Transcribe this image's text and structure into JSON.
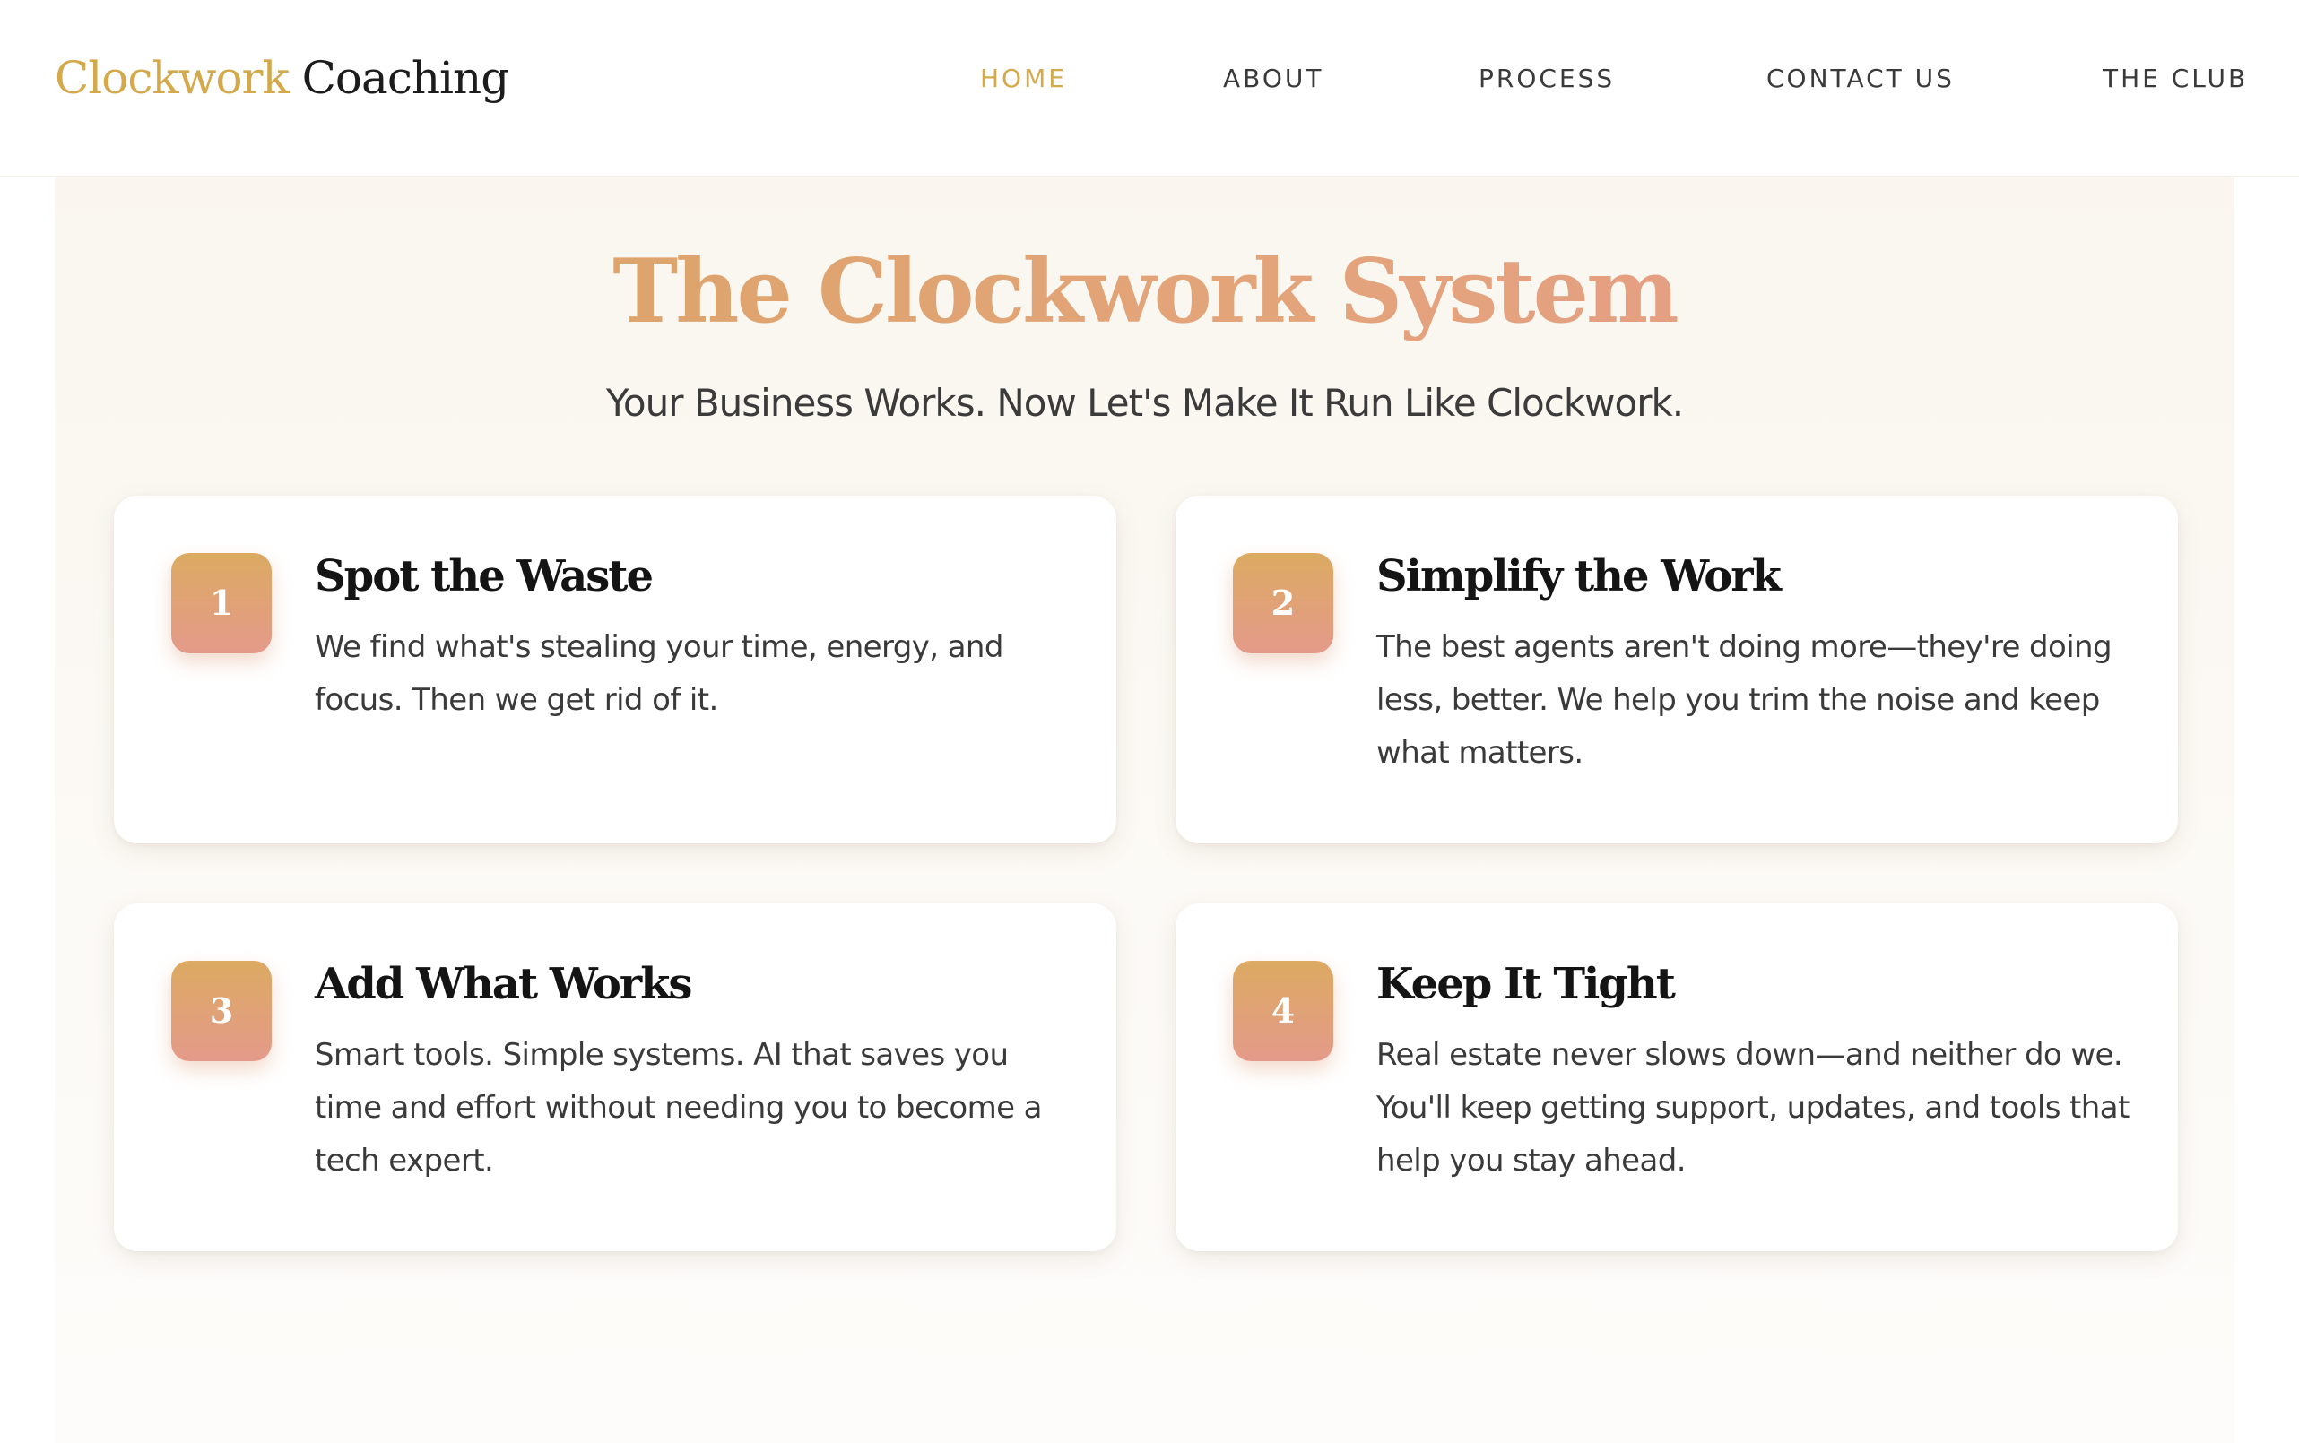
{
  "brand": {
    "accent_word": "Clockwork",
    "rest_word": " Coaching",
    "accent_color": "#d4a94b"
  },
  "nav": {
    "items": [
      {
        "label": "HOME",
        "active": true
      },
      {
        "label": "ABOUT",
        "active": false
      },
      {
        "label": "PROCESS",
        "active": false
      },
      {
        "label": "CONTACT US",
        "active": false
      },
      {
        "label": "THE CLUB",
        "active": false
      }
    ]
  },
  "section": {
    "title": "The Clockwork System",
    "subtitle": "Your Business Works. Now Let's Make It Run Like Clockwork.",
    "title_gradient": [
      "#d9a561",
      "#e59a8c"
    ]
  },
  "steps": [
    {
      "number": "1",
      "title": "Spot the Waste",
      "text": "We find what's stealing your time, energy, and focus. Then we get rid of it."
    },
    {
      "number": "2",
      "title": "Simplify the Work",
      "text": "The best agents aren't doing more—they're doing less, better. We help you trim the noise and keep what matters."
    },
    {
      "number": "3",
      "title": "Add What Works",
      "text": "Smart tools. Simple systems. AI that saves you time and effort without needing you to become a tech expert."
    },
    {
      "number": "4",
      "title": "Keep It Tight",
      "text": "Real estate never slows down—and neither do we. You'll keep getting support, updates, and tools that help you stay ahead."
    }
  ]
}
